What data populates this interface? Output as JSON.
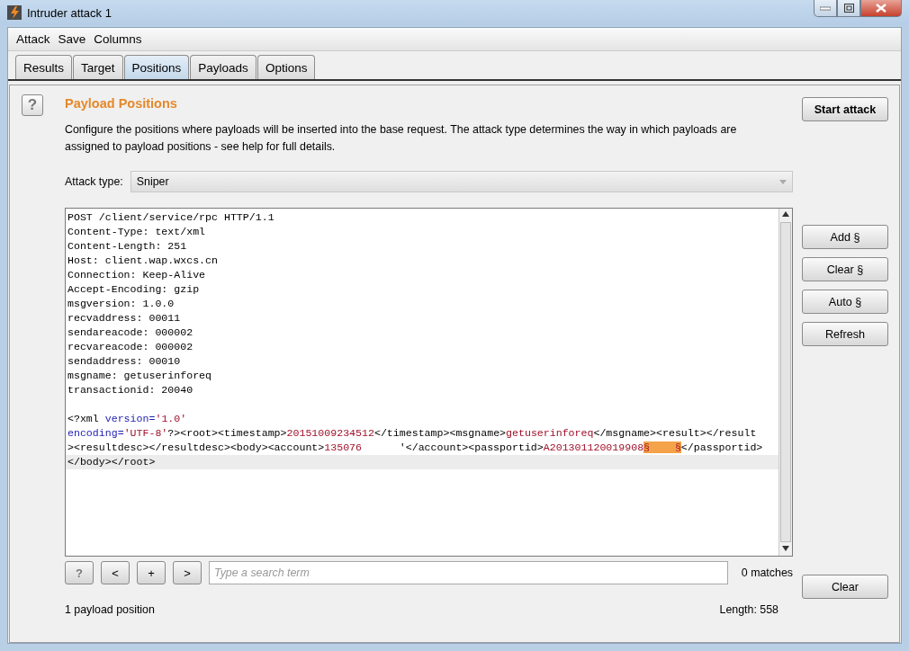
{
  "window": {
    "title": "Intruder attack 1"
  },
  "menu": [
    "Attack",
    "Save",
    "Columns"
  ],
  "tabs": [
    {
      "label": "Results",
      "selected": false
    },
    {
      "label": "Target",
      "selected": false
    },
    {
      "label": "Positions",
      "selected": true
    },
    {
      "label": "Payloads",
      "selected": false
    },
    {
      "label": "Options",
      "selected": false
    }
  ],
  "section": {
    "help_icon": "?",
    "title": "Payload Positions",
    "description": "Configure the positions where payloads will be inserted into the base request. The attack type determines the way in which payloads are assigned to payload positions - see help for full details."
  },
  "start_button": "Start attack",
  "attack_type": {
    "label": "Attack type:",
    "value": "Sniper"
  },
  "request": {
    "lines": [
      {
        "current": false,
        "segments": [
          {
            "kind": "plain",
            "text": "POST /client/service/rpc HTTP/1.1"
          }
        ]
      },
      {
        "current": false,
        "segments": [
          {
            "kind": "plain",
            "text": "Content-Type: text/xml"
          }
        ]
      },
      {
        "current": false,
        "segments": [
          {
            "kind": "plain",
            "text": "Content-Length: 251"
          }
        ]
      },
      {
        "current": false,
        "segments": [
          {
            "kind": "plain",
            "text": "Host: client.wap.wxcs.cn"
          }
        ]
      },
      {
        "current": false,
        "segments": [
          {
            "kind": "plain",
            "text": "Connection: Keep-Alive"
          }
        ]
      },
      {
        "current": false,
        "segments": [
          {
            "kind": "plain",
            "text": "Accept-Encoding: gzip"
          }
        ]
      },
      {
        "current": false,
        "segments": [
          {
            "kind": "plain",
            "text": "msgversion: 1.0.0"
          }
        ]
      },
      {
        "current": false,
        "segments": [
          {
            "kind": "plain",
            "text": "recvaddress: 00011"
          }
        ]
      },
      {
        "current": false,
        "segments": [
          {
            "kind": "plain",
            "text": "sendareacode: 000002"
          }
        ]
      },
      {
        "current": false,
        "segments": [
          {
            "kind": "plain",
            "text": "recvareacode: 000002"
          }
        ]
      },
      {
        "current": false,
        "segments": [
          {
            "kind": "plain",
            "text": "sendaddress: 00010"
          }
        ]
      },
      {
        "current": false,
        "segments": [
          {
            "kind": "plain",
            "text": "msgname: getuserinforeq"
          }
        ]
      },
      {
        "current": false,
        "segments": [
          {
            "kind": "plain",
            "text": "transactionid: 20040"
          }
        ]
      },
      {
        "current": false
      },
      {
        "current": false,
        "segments": [
          {
            "kind": "plain",
            "text": "<?xml "
          },
          {
            "kind": "attr",
            "text": "version="
          },
          {
            "kind": "value",
            "text": "'1.0'"
          }
        ]
      },
      {
        "current": false,
        "segments": [
          {
            "kind": "attr",
            "text": "encoding="
          },
          {
            "kind": "value",
            "text": "'UTF-8'"
          },
          {
            "kind": "plain",
            "text": "?><root><timestamp>"
          },
          {
            "kind": "value",
            "text": "20151009234512"
          },
          {
            "kind": "plain",
            "text": "</timestamp><msgname>"
          },
          {
            "kind": "value",
            "text": "getuserinforeq"
          },
          {
            "kind": "plain",
            "text": "</msgname><result></result"
          }
        ]
      },
      {
        "current": false,
        "segments": [
          {
            "kind": "plain",
            "text": "><resultdesc></resultdesc><body><account>"
          },
          {
            "kind": "value",
            "text": "135076"
          },
          {
            "kind": "plain",
            "text": "      '</account><passportid>"
          },
          {
            "kind": "value",
            "text": "A201301120019908"
          },
          {
            "kind": "marker",
            "text": "§    §"
          },
          {
            "kind": "plain",
            "text": "</passportid>"
          }
        ]
      },
      {
        "current": true,
        "segments": [
          {
            "kind": "plain",
            "text": "</body></root>"
          }
        ]
      }
    ]
  },
  "side_buttons": [
    "Add §",
    "Clear §",
    "Auto §",
    "Refresh"
  ],
  "search": {
    "buttons": [
      "?",
      "<",
      "+",
      ">"
    ],
    "placeholder": "Type a search term",
    "matches": "0 matches",
    "clear": "Clear"
  },
  "status": {
    "positions": "1 payload position",
    "length": "Length: 558"
  }
}
